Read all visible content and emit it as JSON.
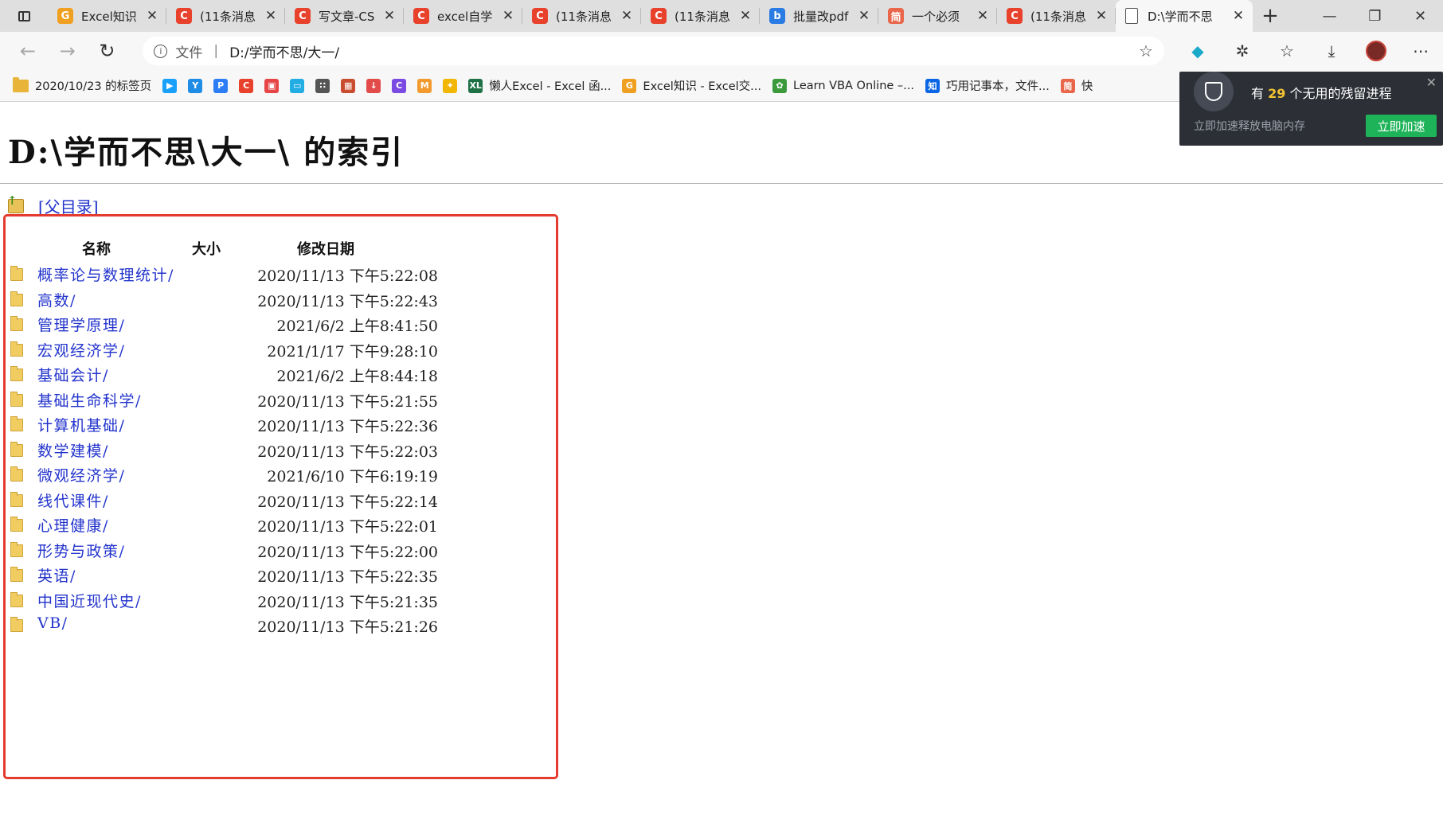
{
  "tabs": [
    {
      "title": "Excel知识",
      "icon": "excel-g-icon",
      "color": "#f0a020",
      "glyph": "G"
    },
    {
      "title": "(11条消息",
      "icon": "csdn-icon",
      "color": "#e8412c",
      "glyph": "C"
    },
    {
      "title": "写文章-CS",
      "icon": "csdn-icon",
      "color": "#e8412c",
      "glyph": "C"
    },
    {
      "title": "excel自学",
      "icon": "csdn-icon",
      "color": "#e8412c",
      "glyph": "C"
    },
    {
      "title": "(11条消息",
      "icon": "csdn-icon",
      "color": "#e8412c",
      "glyph": "C"
    },
    {
      "title": "(11条消息",
      "icon": "csdn-icon",
      "color": "#e8412c",
      "glyph": "C"
    },
    {
      "title": "批量改pdf",
      "icon": "bing-icon",
      "color": "#2a7be4",
      "glyph": "b"
    },
    {
      "title": "一个必须",
      "icon": "jianshu-icon",
      "color": "#e9664b",
      "glyph": "简"
    },
    {
      "title": "(11条消息",
      "icon": "csdn-icon",
      "color": "#e8412c",
      "glyph": "C"
    }
  ],
  "active_tab": {
    "title": "D:\\学而不思"
  },
  "address": {
    "security_label": "文件",
    "url": "D:/学而不思/大一/"
  },
  "bookmarks": [
    {
      "label": "2020/10/23 的标签页",
      "icon": "folder-icon"
    },
    {
      "label": "",
      "icon": "tencent-video-icon",
      "color": "#18a0fb",
      "glyph": "▶"
    },
    {
      "label": "",
      "icon": "youku-icon",
      "color": "#1f8ce6",
      "glyph": "Y"
    },
    {
      "label": "",
      "icon": "p-icon",
      "color": "#2d7df6",
      "glyph": "P"
    },
    {
      "label": "",
      "icon": "csdn-icon",
      "color": "#e8412c",
      "glyph": "C"
    },
    {
      "label": "",
      "icon": "red-app-icon",
      "color": "#e64545",
      "glyph": "▣"
    },
    {
      "label": "",
      "icon": "bilibili-icon",
      "color": "#23ade5",
      "glyph": "▭"
    },
    {
      "label": "",
      "icon": "dots-icon",
      "color": "#555555",
      "glyph": "∷"
    },
    {
      "label": "",
      "icon": "puzzle-icon",
      "color": "#c94c2e",
      "glyph": "▦"
    },
    {
      "label": "",
      "icon": "download-icon",
      "color": "#e34b4b",
      "glyph": "↓"
    },
    {
      "label": "",
      "icon": "circle-c-icon",
      "color": "#7b4ae2",
      "glyph": "C"
    },
    {
      "label": "",
      "icon": "m-icon",
      "color": "#f29a2e",
      "glyph": "M"
    },
    {
      "label": "",
      "icon": "sparkle-icon",
      "color": "#f2b705",
      "glyph": "✦"
    },
    {
      "label": "懒人Excel - Excel 函...",
      "icon": "xl-icon",
      "color": "#1e7145",
      "glyph": "XL"
    },
    {
      "label": "Excel知识 - Excel交...",
      "icon": "excel-g-icon",
      "color": "#f0a020",
      "glyph": "G"
    },
    {
      "label": "Learn VBA Online –...",
      "icon": "vba-icon",
      "color": "#3c9a3c",
      "glyph": "✿"
    },
    {
      "label": "巧用记事本，文件...",
      "icon": "zhihu-icon",
      "color": "#0a66e4",
      "glyph": "知"
    },
    {
      "label": "快",
      "icon": "jianshu-icon",
      "color": "#e9664b",
      "glyph": "简"
    }
  ],
  "page": {
    "heading": "D:\\学而不思\\大一\\ 的索引",
    "parent_link": "[父目录]",
    "columns": {
      "name": "名称",
      "size": "大小",
      "modified": "修改日期"
    },
    "entries": [
      {
        "name": "概率论与数理统计/",
        "modified": "2020/11/13 下午5:22:08"
      },
      {
        "name": "高数/",
        "modified": "2020/11/13 下午5:22:43"
      },
      {
        "name": "管理学原理/",
        "modified": "2021/6/2 上午8:41:50"
      },
      {
        "name": "宏观经济学/",
        "modified": "2021/1/17 下午9:28:10"
      },
      {
        "name": "基础会计/",
        "modified": "2021/6/2 上午8:44:18"
      },
      {
        "name": "基础生命科学/",
        "modified": "2020/11/13 下午5:21:55"
      },
      {
        "name": "计算机基础/",
        "modified": "2020/11/13 下午5:22:36"
      },
      {
        "name": "数学建模/",
        "modified": "2020/11/13 下午5:22:03"
      },
      {
        "name": "微观经济学/",
        "modified": "2021/6/10 下午6:19:19"
      },
      {
        "name": "线代课件/",
        "modified": "2020/11/13 下午5:22:14"
      },
      {
        "name": "心理健康/",
        "modified": "2020/11/13 下午5:22:01"
      },
      {
        "name": "形势与政策/",
        "modified": "2020/11/13 下午5:22:00"
      },
      {
        "name": "英语/",
        "modified": "2020/11/13 下午5:22:35"
      },
      {
        "name": "中国近现代史/",
        "modified": "2020/11/13 下午5:21:35"
      },
      {
        "name": "VB/",
        "modified": "2020/11/13 下午5:21:26"
      }
    ]
  },
  "popup": {
    "prefix": "有 ",
    "count": "29",
    "suffix": " 个无用的残留进程",
    "subtext": "立即加速释放电脑内存",
    "button": "立即加速"
  },
  "colors": {
    "highlight_border": "#e53a2e",
    "link": "#2233cc",
    "popup_button": "#1fb359"
  }
}
